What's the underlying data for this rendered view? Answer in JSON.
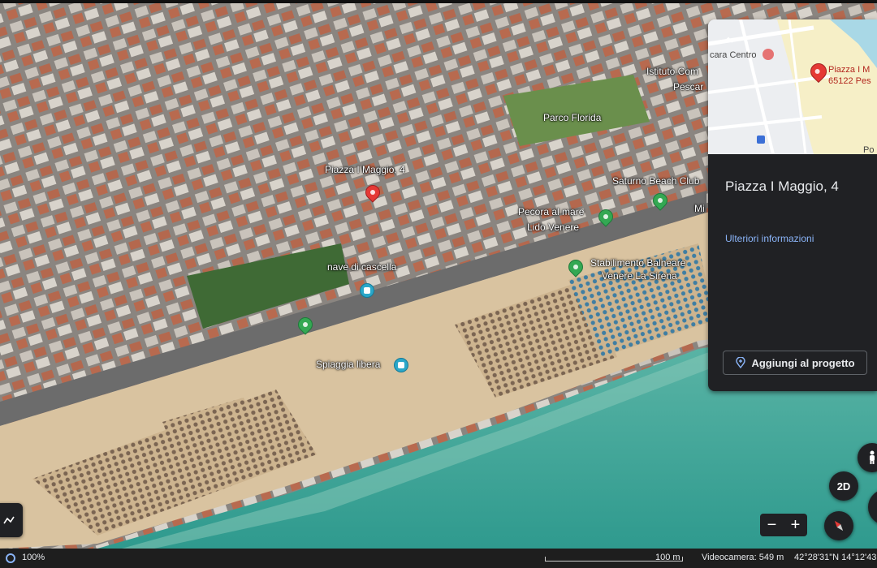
{
  "map": {
    "labels": {
      "piazza": "Piazza I Maggio, 4",
      "parco_florida": "Parco Florida",
      "saturno": "Saturno Beach Club",
      "pecora_1": "Pecora al mare",
      "pecora_2": "Lido Venere",
      "mi": "Mi",
      "stabilimento_1": "Stabilimento Balneare",
      "stabilimento_2": "Venere La Sirena",
      "nave": "nave di cascella",
      "spiaggia": "Spiaggia libera",
      "istituto_1": "Istituto Com",
      "istituto_2": "Pescar"
    }
  },
  "panel": {
    "minimap": {
      "label_centro": "cara Centro",
      "label_piazza_1": "Piazza I M",
      "label_piazza_2": "65122 Pes",
      "label_po": "Po"
    },
    "title": "Piazza I Maggio, 4",
    "more_info": "Ulteriori informazioni",
    "add_button": "Aggiungi al progetto",
    "collapse_icon": "chevron-up-icon"
  },
  "controls": {
    "view_2d": "2D",
    "zoom_out": "−",
    "zoom_in": "+",
    "pegman_icon": "person-icon",
    "compass_icon": "compass-icon",
    "measure_icon": "measure-icon"
  },
  "status": {
    "loading": "100%",
    "scale": "100 m",
    "camera": "Videocamera: 549 m",
    "coords": "42°28'31\"N 14°12'43"
  },
  "colors": {
    "sea": "#3aa89a",
    "sand": "#d9c3a0",
    "panel_bg": "#202124",
    "link": "#8ab4f8",
    "pin_red": "#e53935",
    "pin_green": "#34a853"
  }
}
